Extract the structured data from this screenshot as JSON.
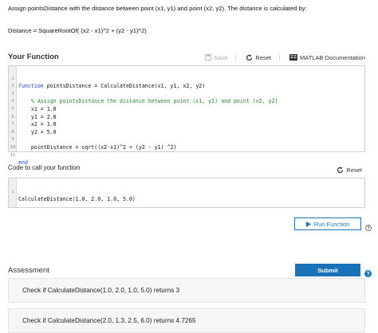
{
  "problem": {
    "prompt": "Assign pointsDistance with the distance between point (x1, y1) and point (x2, y2). The distance is calculated by:",
    "formula": "Distance =  SquareRootOf( (x2 - x1)^2 + (y2 - y1)^2)"
  },
  "your_function": {
    "title": "Your Function",
    "save_label": "Save",
    "reset_label": "Reset",
    "docs_label": "MATLAB Documentation",
    "lines": [
      {
        "n": "1",
        "kw": "function",
        "code": " pointsDistance = CalculateDistance(x1, y1, x2, y2)"
      },
      {
        "n": "2",
        "kw": "",
        "code": ""
      },
      {
        "n": "3",
        "kw": "",
        "comment": "    % Assign pointsDistance the distance between point (x1, y1) and point (x2, y2)"
      },
      {
        "n": "4",
        "kw": "",
        "code": "    x1 = 1.0"
      },
      {
        "n": "5",
        "kw": "",
        "code": "    y1 = 2.0"
      },
      {
        "n": "6",
        "kw": "",
        "code": "    x2 = 1.0"
      },
      {
        "n": "7",
        "kw": "",
        "code": "    y2 = 5.0"
      },
      {
        "n": "8",
        "kw": "",
        "code": ""
      },
      {
        "n": "9",
        "kw": "",
        "code": "    pointDistance = sqrt((x2-x1)^2 + (y2 - y1) ^2)"
      },
      {
        "n": "10",
        "kw": "",
        "code": ""
      },
      {
        "n": "11",
        "kw": "end",
        "code": ""
      }
    ]
  },
  "call_code": {
    "title": "Code to call your function",
    "reset_label": "Reset",
    "lines": [
      {
        "n": "1",
        "code": "CalculateDistance(1.0, 2.0, 1.0, 5.0)"
      }
    ],
    "run_label": "Run Function"
  },
  "assessment": {
    "title": "Assessment",
    "submit_label": "Submit",
    "checks": [
      "Check if CalculateDistance(1.0, 2.0, 1.0, 5.0) returns 3",
      "Check if CalculateDistance(2.0, 1.3, 2.5, 6.0) returns 4.7265"
    ]
  },
  "icons": {
    "save": "save-icon",
    "reset": "reset-icon",
    "docs": "documentation-icon",
    "run": "play-icon",
    "help": "help-icon"
  },
  "colors": {
    "accent": "#1a73b8",
    "keyword": "#1c3cc9",
    "comment": "#1f8a2b"
  }
}
